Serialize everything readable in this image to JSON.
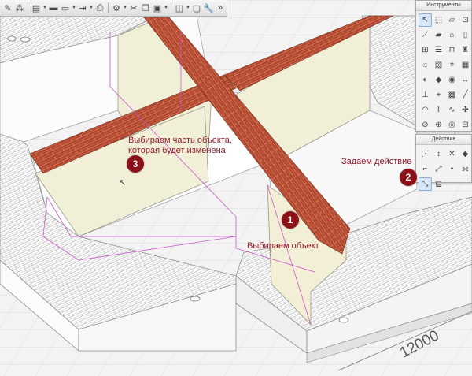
{
  "toolbar": {
    "buttons": [
      {
        "name": "pencil-button",
        "icon": "pencil-icon",
        "glyph": "✎",
        "dropdown": false
      },
      {
        "name": "magic-wand-button",
        "icon": "magic-wand-icon",
        "glyph": "⁂",
        "dropdown": false
      },
      {
        "name": "layers-button",
        "icon": "layers-icon",
        "glyph": "▤",
        "dropdown": true
      },
      {
        "name": "save-button",
        "icon": "floppy-icon",
        "glyph": "▬",
        "dropdown": false
      },
      {
        "name": "open-button",
        "icon": "folder-icon",
        "glyph": "▭",
        "dropdown": true
      },
      {
        "name": "export-button",
        "icon": "export-icon",
        "glyph": "⇥",
        "dropdown": true
      },
      {
        "name": "print-button",
        "icon": "printer-icon",
        "glyph": "⎙",
        "dropdown": false
      },
      {
        "name": "settings-button",
        "icon": "gear-icon",
        "glyph": "⚙",
        "dropdown": true
      },
      {
        "name": "cut-button",
        "icon": "scissors-icon",
        "glyph": "✂",
        "dropdown": false
      },
      {
        "name": "copy-button",
        "icon": "copy-icon",
        "glyph": "❐",
        "dropdown": false
      },
      {
        "name": "paste-button",
        "icon": "clipboard-icon",
        "glyph": "▣",
        "dropdown": true
      },
      {
        "name": "view-button",
        "icon": "windows-icon",
        "glyph": "◫",
        "dropdown": true
      },
      {
        "name": "window-button",
        "icon": "window-icon",
        "glyph": "▢",
        "dropdown": false
      },
      {
        "name": "wrench-button",
        "icon": "wrench-icon",
        "glyph": "🔧",
        "dropdown": false
      },
      {
        "name": "more-button",
        "icon": "overflow-icon",
        "glyph": "»",
        "dropdown": false
      }
    ]
  },
  "tools_palette": {
    "title": "Инструменты",
    "items": [
      {
        "name": "arrow-select-tool",
        "glyph": "↖",
        "selected": true
      },
      {
        "name": "marquee-tool",
        "glyph": "⬚"
      },
      {
        "name": "wall-tool",
        "glyph": "▱"
      },
      {
        "name": "column-tool",
        "glyph": "⊡"
      },
      {
        "name": "beam-tool",
        "glyph": "⟋"
      },
      {
        "name": "slab-tool",
        "glyph": "▰"
      },
      {
        "name": "roof-tool",
        "glyph": "⌂"
      },
      {
        "name": "door-tool",
        "glyph": "▯"
      },
      {
        "name": "window-tool",
        "glyph": "⊞"
      },
      {
        "name": "stair-tool",
        "glyph": "☰"
      },
      {
        "name": "railing-tool",
        "glyph": "⊓"
      },
      {
        "name": "object-tool",
        "glyph": "♜"
      },
      {
        "name": "lamp-tool",
        "glyph": "☼"
      },
      {
        "name": "zone-tool",
        "glyph": "▧"
      },
      {
        "name": "mesh-tool",
        "glyph": "⌗"
      },
      {
        "name": "curtain-wall-tool",
        "glyph": "▦"
      },
      {
        "name": "shell-tool",
        "glyph": "◐"
      },
      {
        "name": "morph-tool",
        "glyph": "◆"
      },
      {
        "name": "camera-tool",
        "glyph": "◉"
      },
      {
        "name": "dimension-tool",
        "glyph": "↔"
      },
      {
        "name": "level-tool",
        "glyph": "⊥"
      },
      {
        "name": "label-tool",
        "glyph": "⌖"
      },
      {
        "name": "fill-tool",
        "glyph": "▩"
      },
      {
        "name": "line-tool",
        "glyph": "╱"
      },
      {
        "name": "arc-tool",
        "glyph": "◠"
      },
      {
        "name": "polyline-tool",
        "glyph": "⌇"
      },
      {
        "name": "spline-tool",
        "glyph": "∿"
      },
      {
        "name": "hotspot-tool",
        "glyph": "✣"
      },
      {
        "name": "section-tool",
        "glyph": "⊘"
      },
      {
        "name": "elevation-tool",
        "glyph": "⊕"
      },
      {
        "name": "detail-tool",
        "glyph": "◎"
      },
      {
        "name": "worksheet-tool",
        "glyph": "⊟"
      },
      {
        "name": "figure-tool",
        "glyph": "▣"
      },
      {
        "name": "grid-tool",
        "glyph": "⋕"
      },
      {
        "name": "change-tool",
        "glyph": "◈"
      },
      {
        "name": "drawing-tool",
        "glyph": "▤"
      },
      {
        "name": "text-tool",
        "glyph": "T"
      }
    ]
  },
  "actions_palette": {
    "title": "Действие",
    "items": [
      {
        "name": "offset-edge-action",
        "glyph": "⋰"
      },
      {
        "name": "stretch-action",
        "glyph": "↕"
      },
      {
        "name": "split-action",
        "glyph": "✕"
      },
      {
        "name": "move-action",
        "glyph": "◆"
      },
      {
        "name": "corner-action",
        "glyph": "⌐"
      },
      {
        "name": "rotate-action",
        "glyph": "⤢"
      },
      {
        "name": "trim-action",
        "glyph": "▪"
      },
      {
        "name": "mirror-action",
        "glyph": "⟗"
      },
      {
        "name": "elevate-action",
        "glyph": "⤡",
        "selected": true
      },
      {
        "name": "drag-action",
        "glyph": "⊑"
      }
    ]
  },
  "annotations": {
    "step3_text_line1": "Выбираем часть объекта,",
    "step3_text_line2": "которая будет изменена",
    "step2_text": "Задаем действие",
    "step1_text": "Выбираем объект",
    "badge1": "1",
    "badge2": "2",
    "badge3": "3"
  },
  "dimension_label": "12000",
  "colors": {
    "brick": "#b2452b",
    "wall_face": "#f2efd8",
    "badge": "#8d1119",
    "callout_text": "#8b1a2a",
    "selection_lines": "#cc55cc"
  }
}
